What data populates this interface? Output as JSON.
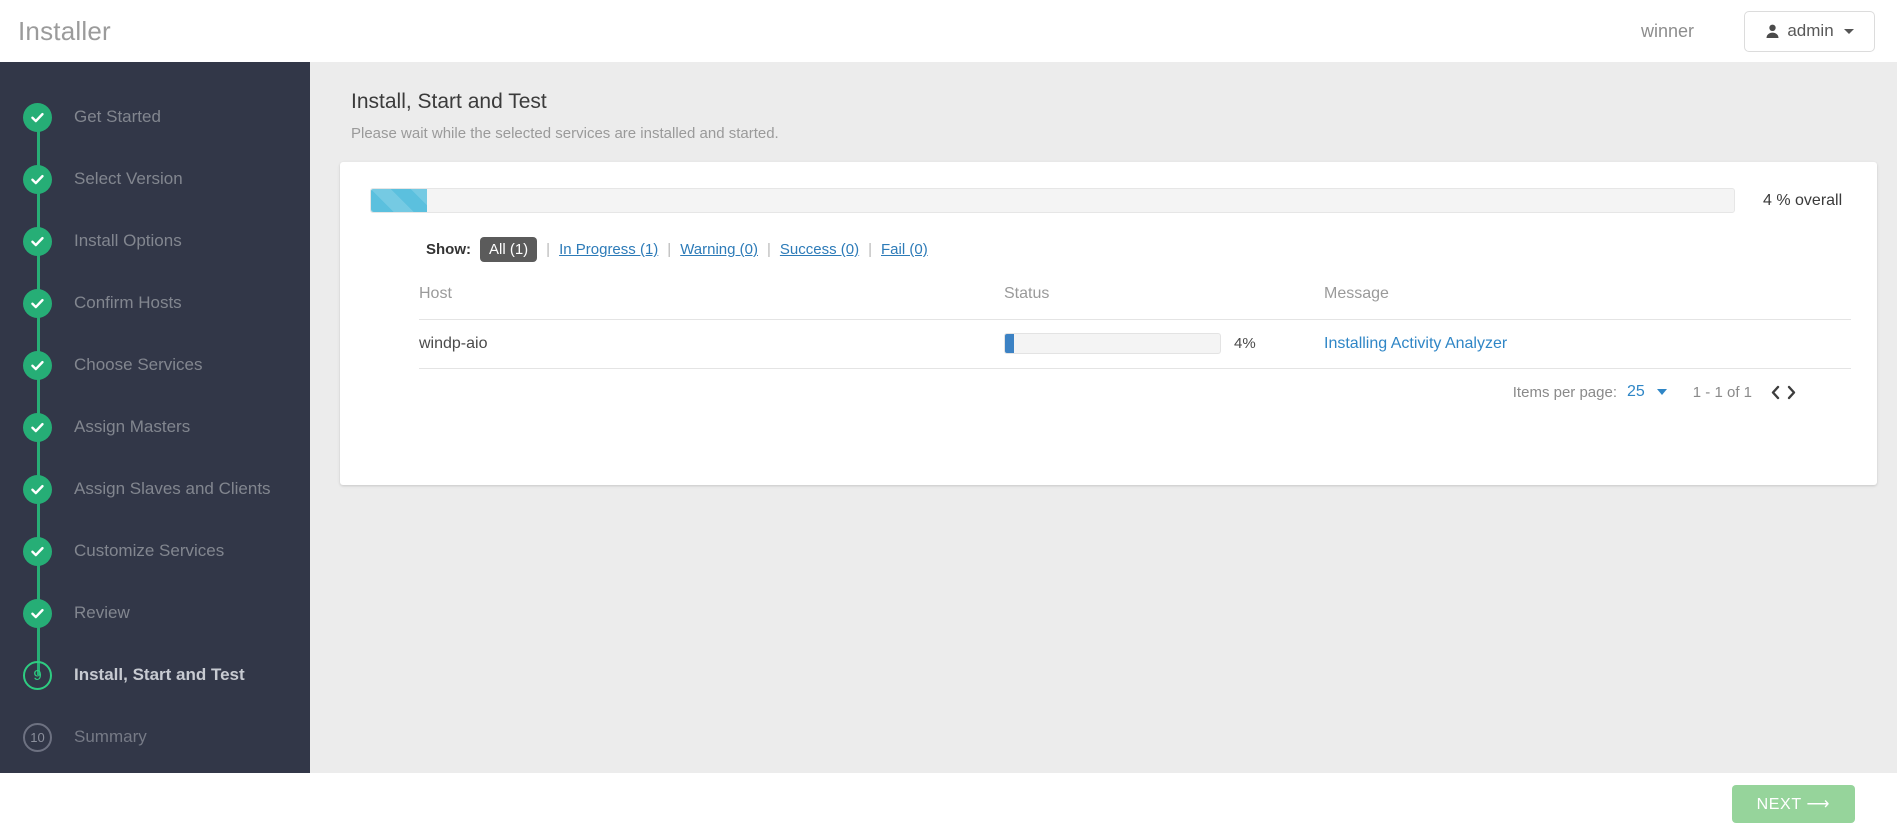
{
  "header": {
    "app_title": "Installer",
    "cluster_name": "winner",
    "user_label": "admin",
    "user_icon": "user-icon",
    "caret_icon": "caret-down-icon"
  },
  "sidebar": {
    "items": [
      {
        "label": "Get Started",
        "state": "done",
        "marker": "check"
      },
      {
        "label": "Select Version",
        "state": "done",
        "marker": "check"
      },
      {
        "label": "Install Options",
        "state": "done",
        "marker": "check"
      },
      {
        "label": "Confirm Hosts",
        "state": "done",
        "marker": "check"
      },
      {
        "label": "Choose Services",
        "state": "done",
        "marker": "check"
      },
      {
        "label": "Assign Masters",
        "state": "done",
        "marker": "check"
      },
      {
        "label": "Assign Slaves and Clients",
        "state": "done",
        "marker": "check"
      },
      {
        "label": "Customize Services",
        "state": "done",
        "marker": "check"
      },
      {
        "label": "Review",
        "state": "done",
        "marker": "check"
      },
      {
        "label": "Install, Start and Test",
        "state": "current",
        "marker": "9"
      },
      {
        "label": "Summary",
        "state": "pending",
        "marker": "10"
      }
    ]
  },
  "main": {
    "title": "Install, Start and Test",
    "subtitle": "Please wait while the selected services are installed and started.",
    "overall": {
      "percent": 4,
      "text": "4 % overall"
    },
    "filter": {
      "label": "Show:",
      "options": [
        {
          "label": "All (1)",
          "active": true
        },
        {
          "label": "In Progress (1)",
          "active": false
        },
        {
          "label": "Warning (0)",
          "active": false
        },
        {
          "label": "Success (0)",
          "active": false
        },
        {
          "label": "Fail (0)",
          "active": false
        }
      ],
      "separator": "|"
    },
    "table": {
      "columns": [
        "Host",
        "Status",
        "Message"
      ],
      "rows": [
        {
          "host": "windp-aio",
          "status_percent": 4,
          "status_text": "4%",
          "message": "Installing Activity Analyzer"
        }
      ]
    },
    "paginator": {
      "items_per_page_label": "Items per page:",
      "items_per_page_value": "25",
      "range": "1 - 1 of 1",
      "prev_icon": "chevron-left-icon",
      "next_icon": "chevron-right-icon"
    }
  },
  "footer": {
    "next_label": "NEXT ⟶"
  },
  "colors": {
    "sidebar_bg": "#323748",
    "accent_green": "#26ae76",
    "progress_blue": "#5bc0de",
    "row_blue": "#3c82c4",
    "link_blue": "#2f86c6",
    "next_button": "#96d49b"
  }
}
